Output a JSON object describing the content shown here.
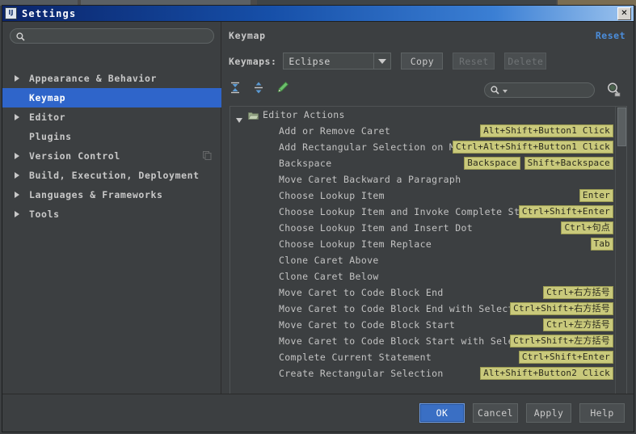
{
  "window": {
    "title": "Settings",
    "app_icon": "IJ",
    "close_icon": "close-icon",
    "close_glyph": "✕"
  },
  "sidebar": {
    "search": {
      "value": "",
      "placeholder": "",
      "icon": "search-icon"
    },
    "items": [
      {
        "label": "Appearance & Behavior",
        "expandable": true,
        "selected": false,
        "badge": null
      },
      {
        "label": "Keymap",
        "expandable": false,
        "selected": true,
        "badge": null
      },
      {
        "label": "Editor",
        "expandable": true,
        "selected": false,
        "badge": null
      },
      {
        "label": "Plugins",
        "expandable": false,
        "selected": false,
        "badge": null
      },
      {
        "label": "Version Control",
        "expandable": true,
        "selected": false,
        "badge": "copy-icon"
      },
      {
        "label": "Build, Execution, Deployment",
        "expandable": true,
        "selected": false,
        "badge": null
      },
      {
        "label": "Languages & Frameworks",
        "expandable": true,
        "selected": false,
        "badge": null
      },
      {
        "label": "Tools",
        "expandable": true,
        "selected": false,
        "badge": null
      }
    ]
  },
  "main": {
    "title": "Keymap",
    "reset_link": "Reset",
    "keymaps_label": "Keymaps:",
    "keymap_selected": "Eclipse",
    "buttons": [
      {
        "label": "Copy",
        "disabled": false
      },
      {
        "label": "Reset",
        "disabled": true
      },
      {
        "label": "Delete",
        "disabled": true
      }
    ],
    "toolbar_icons": [
      {
        "name": "collapse-all-icon"
      },
      {
        "name": "expand-all-icon"
      },
      {
        "name": "edit-shortcut-icon"
      }
    ],
    "filter_search": {
      "value": "",
      "placeholder": "",
      "icon": "search-icon"
    },
    "find_by_shortcut_icon": "find-by-shortcut-icon",
    "tree_root": {
      "label": "Editor Actions",
      "icon": "folder-icon",
      "expanded": true
    },
    "actions": [
      {
        "name": "Add or Remove Caret",
        "shortcuts": [
          "Alt+Shift+Button1 Click"
        ]
      },
      {
        "name": "Add Rectangular Selection on Mouse Drag",
        "shortcuts": [
          "Ctrl+Alt+Shift+Button1 Click"
        ]
      },
      {
        "name": "Backspace",
        "shortcuts": [
          "Backspace",
          "Shift+Backspace"
        ]
      },
      {
        "name": "Move Caret Backward a Paragraph",
        "shortcuts": []
      },
      {
        "name": "Choose Lookup Item",
        "shortcuts": [
          "Enter"
        ]
      },
      {
        "name": "Choose Lookup Item and Invoke Complete Statement",
        "shortcuts": [
          "Ctrl+Shift+Enter"
        ]
      },
      {
        "name": "Choose Lookup Item and Insert Dot",
        "shortcuts": [
          "Ctrl+句点"
        ]
      },
      {
        "name": "Choose Lookup Item Replace",
        "shortcuts": [
          "Tab"
        ]
      },
      {
        "name": "Clone Caret Above",
        "shortcuts": []
      },
      {
        "name": "Clone Caret Below",
        "shortcuts": []
      },
      {
        "name": "Move Caret to Code Block End",
        "shortcuts": [
          "Ctrl+右方括号"
        ]
      },
      {
        "name": "Move Caret to Code Block End with Selection",
        "shortcuts": [
          "Ctrl+Shift+右方括号"
        ]
      },
      {
        "name": "Move Caret to Code Block Start",
        "shortcuts": [
          "Ctrl+左方括号"
        ]
      },
      {
        "name": "Move Caret to Code Block Start with Selection",
        "shortcuts": [
          "Ctrl+Shift+左方括号"
        ]
      },
      {
        "name": "Complete Current Statement",
        "shortcuts": [
          "Ctrl+Shift+Enter"
        ]
      },
      {
        "name": "Create Rectangular Selection",
        "shortcuts": [
          "Alt+Shift+Button2 Click"
        ]
      }
    ]
  },
  "footer": {
    "buttons": [
      {
        "label": "OK",
        "default": true
      },
      {
        "label": "Cancel",
        "default": false
      },
      {
        "label": "Apply",
        "default": false
      },
      {
        "label": "Help",
        "default": false
      }
    ]
  },
  "colors": {
    "accent_selection": "#2f65ca",
    "link": "#4b8ddb",
    "shortcut_badge": "#c9c97b",
    "window_bg": "#3c3f41",
    "titlebar_start": "#0a246a"
  }
}
